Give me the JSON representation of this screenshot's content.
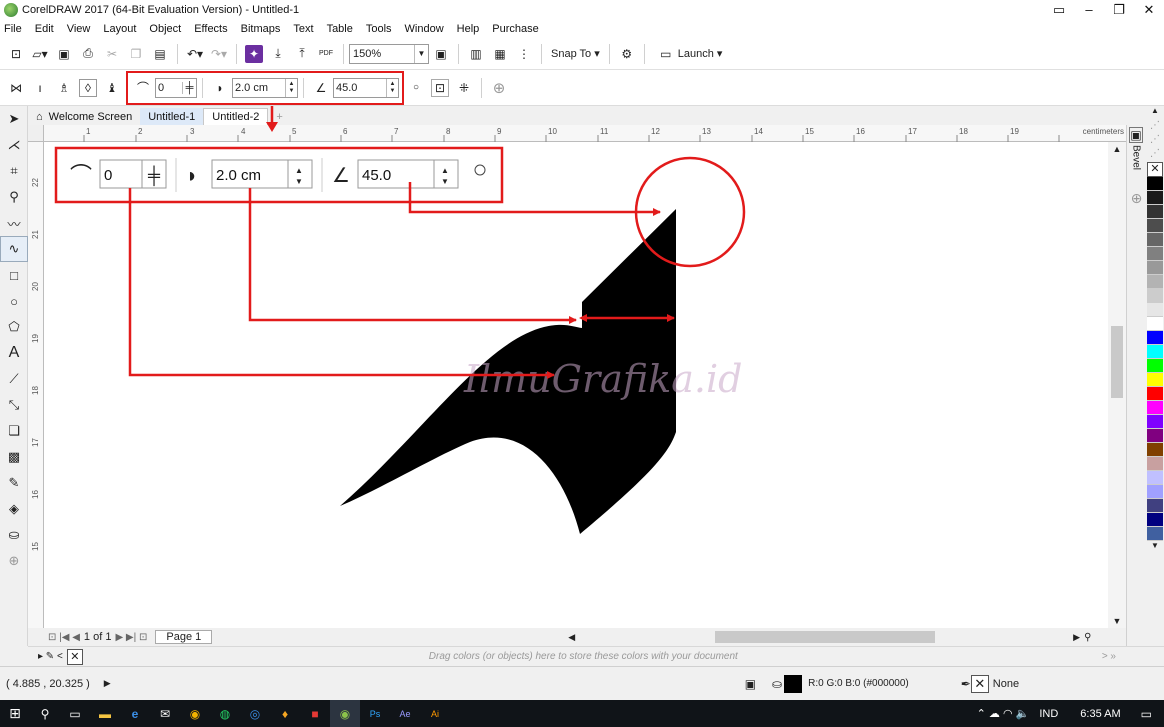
{
  "window": {
    "title": "CorelDRAW 2017 (64-Bit Evaluation Version) - Untitled-1",
    "controls": [
      "▭",
      "–",
      "❐",
      "✕"
    ]
  },
  "menu": [
    "File",
    "Edit",
    "View",
    "Layout",
    "Object",
    "Effects",
    "Bitmaps",
    "Text",
    "Table",
    "Tools",
    "Window",
    "Help",
    "Purchase"
  ],
  "standard_toolbar": {
    "zoom_value": "150%",
    "snap_label": "Snap To",
    "launch_label": "Launch",
    "pdf_label": "PDF"
  },
  "property_bar": {
    "smoothing": "0",
    "width": "2.0 cm",
    "angle": "45.0"
  },
  "callout": {
    "smoothing": "0",
    "width": "2.0 cm",
    "angle": "45.0"
  },
  "doc_tabs": [
    "Welcome Screen",
    "Untitled-1",
    "Untitled-2"
  ],
  "ruler": {
    "unit_label": "centimeters",
    "h_ticks": [
      "1",
      "2",
      "3",
      "4",
      "5",
      "6",
      "7",
      "8",
      "9",
      "10",
      "11",
      "12",
      "13",
      "14",
      "15",
      "16",
      "17",
      "18",
      "19"
    ],
    "v_ticks": [
      "22",
      "21",
      "20",
      "19",
      "18",
      "17",
      "16",
      "15"
    ]
  },
  "docker_tab": "Bevel",
  "watermark": "IlmuGrafika.id",
  "page_nav": {
    "position": "1 of 1",
    "page_tab": "Page 1"
  },
  "color_doc_hint": "Drag colors (or objects) here to store these colors with your document",
  "status": {
    "coordinates": "( 4.885 , 20.325 )",
    "fill_info": "R:0 G:0 B:0 (#000000)",
    "outline_info": "None"
  },
  "palette_colors": [
    "#000000",
    "#1a1a1a",
    "#333333",
    "#4d4d4d",
    "#666666",
    "#808080",
    "#999999",
    "#b3b3b3",
    "#cccccc",
    "#e6e6e6",
    "#ffffff",
    "#0000ff",
    "#00ffff",
    "#00ff00",
    "#ffff00",
    "#ff0000",
    "#ff00ff",
    "#8000ff",
    "#800080",
    "#804000",
    "#c8a0a0",
    "#c0c0ff",
    "#a0a0ff",
    "#404080",
    "#000080",
    "#4060a0"
  ],
  "colors": {
    "accent_red": "#e21b1b",
    "shape_fill": "#000000",
    "taskbar": "#101418"
  },
  "taskbar": {
    "language": "IND",
    "time": "6:35 AM"
  }
}
